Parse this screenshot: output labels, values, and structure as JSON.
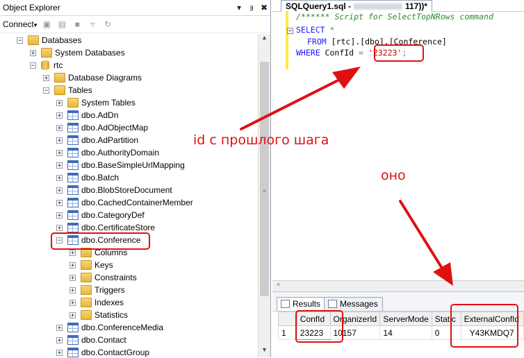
{
  "object_explorer": {
    "title": "Object Explorer",
    "pin": "▾",
    "pin2": "ⱻ",
    "close": "✖",
    "connect_label": "Connect",
    "connect_arrow": "▾",
    "tree": [
      {
        "label": "Databases",
        "expander": "−",
        "icon": "folder-icon"
      },
      {
        "label": "System Databases",
        "expander": "+",
        "icon": "folder-icon"
      },
      {
        "label": "rtc",
        "expander": "−",
        "icon": "database-icon"
      },
      {
        "label": "Database Diagrams",
        "expander": "+",
        "icon": "folder-icon"
      },
      {
        "label": "Tables",
        "expander": "−",
        "icon": "folder-icon"
      },
      {
        "label": "System Tables",
        "expander": "+",
        "icon": "folder-icon"
      },
      {
        "label": "dbo.AdDn",
        "expander": "+",
        "icon": "table-icon"
      },
      {
        "label": "dbo.AdObjectMap",
        "expander": "+",
        "icon": "table-icon"
      },
      {
        "label": "dbo.AdPartition",
        "expander": "+",
        "icon": "table-icon"
      },
      {
        "label": "dbo.AuthorityDomain",
        "expander": "+",
        "icon": "table-icon"
      },
      {
        "label": "dbo.BaseSimpleUrlMapping",
        "expander": "+",
        "icon": "table-icon"
      },
      {
        "label": "dbo.Batch",
        "expander": "+",
        "icon": "table-icon"
      },
      {
        "label": "dbo.BlobStoreDocument",
        "expander": "+",
        "icon": "table-icon"
      },
      {
        "label": "dbo.CachedContainerMember",
        "expander": "+",
        "icon": "table-icon"
      },
      {
        "label": "dbo.CategoryDef",
        "expander": "+",
        "icon": "table-icon"
      },
      {
        "label": "dbo.CertificateStore",
        "expander": "+",
        "icon": "table-icon"
      },
      {
        "label": "dbo.Conference",
        "expander": "−",
        "icon": "table-icon"
      },
      {
        "label": "Columns",
        "expander": "+",
        "icon": "folder-icon"
      },
      {
        "label": "Keys",
        "expander": "+",
        "icon": "folder-icon"
      },
      {
        "label": "Constraints",
        "expander": "+",
        "icon": "folder-icon"
      },
      {
        "label": "Triggers",
        "expander": "+",
        "icon": "folder-icon"
      },
      {
        "label": "Indexes",
        "expander": "+",
        "icon": "folder-icon"
      },
      {
        "label": "Statistics",
        "expander": "+",
        "icon": "folder-icon"
      },
      {
        "label": "dbo.ConferenceMedia",
        "expander": "+",
        "icon": "table-icon"
      },
      {
        "label": "dbo.Contact",
        "expander": "+",
        "icon": "table-icon"
      },
      {
        "label": "dbo.ContactGroup",
        "expander": "+",
        "icon": "table-icon"
      }
    ]
  },
  "editor": {
    "tab_prefix": "SQLQuery1.sql -",
    "tab_suffix": "117))*",
    "lines": {
      "l1": "/****** Script for SelectTopNRows command",
      "l2_kw": "SELECT",
      "l2_rest": " *",
      "l3_kw": "FROM",
      "l3_rest": " [rtc].[dbo].[Conference]",
      "l4_kw": "WHERE",
      "l4_col": " ConfId ",
      "l4_op": "=",
      "l4_str": "'23223'",
      "l4_end": ";"
    },
    "hscroll_left": "<"
  },
  "results": {
    "tab_results": "Results",
    "tab_messages": "Messages",
    "columns": [
      "ConfId",
      "OrganizerId",
      "ServerMode",
      "Static",
      "ExternalConfId"
    ],
    "rows": [
      {
        "num": "1",
        "cells": [
          "23223",
          "10157",
          "14",
          "0",
          "Y43KMDQ7"
        ]
      }
    ]
  },
  "annotations": {
    "note_id": "id с прошлого шага",
    "note_it": "оно",
    "color": "#e01010"
  }
}
